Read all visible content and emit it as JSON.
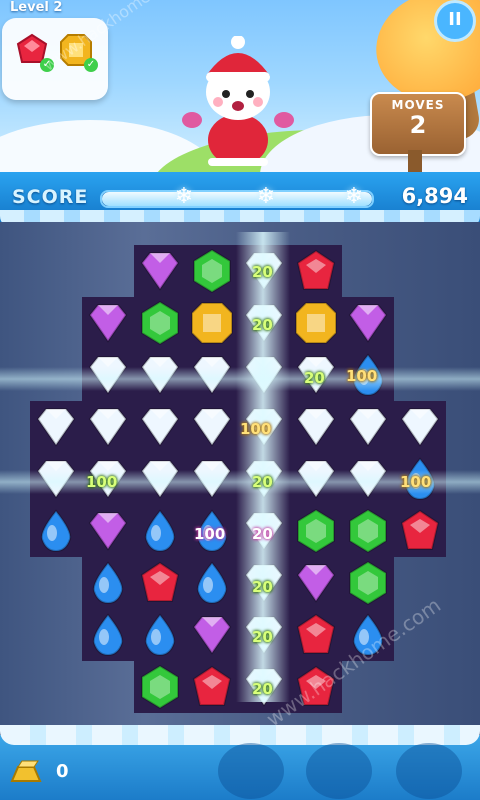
{
  "header": {
    "level_label": "Level 2",
    "goals": [
      {
        "gem": "red-gem",
        "status": "complete"
      },
      {
        "gem": "yellow-gem",
        "status": "complete"
      }
    ],
    "pause_symbol": "II"
  },
  "moves": {
    "label": "MOVES",
    "value": "2"
  },
  "score": {
    "label": "SCORE",
    "value": "6,894",
    "progress_fraction": 1.0
  },
  "point_popups": [
    "20",
    "20",
    "20",
    "100",
    "100",
    "20",
    "100",
    "100",
    "20",
    "100",
    "20",
    "20",
    "20"
  ],
  "bottom": {
    "gold_count": "0"
  },
  "watermark": "www.hackhome.com",
  "colors": {
    "score_bar": "#1f8fe0",
    "board_cell": "#2b1d4a",
    "red_gem": "#e8253f",
    "green_gem": "#33c83b",
    "yellow_gem": "#f2b51f",
    "purple_gem": "#c25ee6",
    "blue_gem": "#2b8ef0",
    "white_gem": "#eef7ff"
  }
}
